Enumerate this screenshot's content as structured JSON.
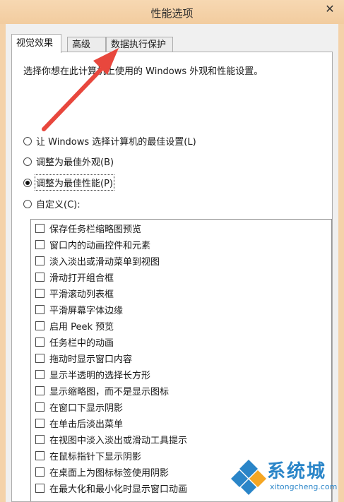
{
  "window": {
    "title": "性能选项",
    "close_glyph": "✕"
  },
  "tabs": [
    {
      "label": "视觉效果",
      "active": true
    },
    {
      "label": "高级",
      "active": false
    },
    {
      "label": "数据执行保护",
      "active": false
    }
  ],
  "visual_effects": {
    "description": "选择你想在此计算机上使用的 Windows 外观和性能设置。",
    "options": [
      {
        "label": "让 Windows 选择计算机的最佳设置(L)",
        "checked": false
      },
      {
        "label": "调整为最佳外观(B)",
        "checked": false
      },
      {
        "label": "调整为最佳性能(P)",
        "checked": true
      },
      {
        "label": "自定义(C):",
        "checked": false
      }
    ],
    "effects": [
      "保存任务栏缩略图预览",
      "窗口内的动画控件和元素",
      "淡入淡出或滑动菜单到视图",
      "滑动打开组合框",
      "平滑滚动列表框",
      "平滑屏幕字体边缘",
      "启用 Peek 预览",
      "任务栏中的动画",
      "拖动时显示窗口内容",
      "显示半透明的选择长方形",
      "显示缩略图，而不是显示图标",
      "在窗口下显示阴影",
      "在单击后淡出菜单",
      "在视图中淡入淡出或滑动工具提示",
      "在鼠标指针下显示阴影",
      "在桌面上为图标标签使用阴影",
      "在最大化和最小化时显示窗口动画"
    ]
  },
  "watermark": {
    "brand": "系统城",
    "site": "xitongcheng.com"
  },
  "annotation": {
    "arrow_color": "#e8473d",
    "icon": "red-arrow-icon"
  }
}
